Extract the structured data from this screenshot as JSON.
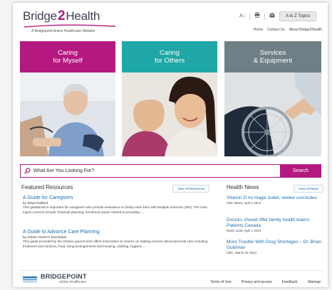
{
  "header": {
    "logo_left": "Bridge",
    "logo_number": "2",
    "logo_right": "Health",
    "tagline": "A Bridgepoint Active Healthcare Website",
    "text_size_label": "A↕",
    "atoz_label": "A to Z Topics",
    "top_links": [
      "Home",
      "Contact Us",
      "About Bridge2Health"
    ]
  },
  "tiles": [
    {
      "line1": "Caring",
      "line2": "for Myself",
      "color": "#b3197f"
    },
    {
      "line1": "Caring",
      "line2": "for Others",
      "color": "#1fa7a7"
    },
    {
      "line1": "Services",
      "line2": "& Equipment",
      "color": "#6f7f86"
    }
  ],
  "search": {
    "placeholder": "What Are You Looking For?",
    "button_label": "Search"
  },
  "featured": {
    "title": "Featured Resources",
    "view_all": "View All Resources",
    "items": [
      {
        "title": "A Guide for Caregivers",
        "by": "by Tanya Radford",
        "desc": "This guidebook is important for caregivers who provide assistance to family mem-bers with Multiple Sclerosis (MS). The main topics covered include: financial planning; emotional issues related to providing ..."
      },
      {
        "title": "A Guide to Advance Care Planning",
        "by": "by Ontario Senior's Secretariat",
        "desc": "This guide provided by the Ontario government offers information to seniors on making choices about personal care including treatment and services, food, living arrangements and housing, clothing, hygiene ..."
      }
    ]
  },
  "news": {
    "title": "Health News",
    "view_all": "View All News",
    "items": [
      {
        "title": "Vitamin D no magic bullet, review concludes",
        "source": "CBC News, April 1 2014"
      },
      {
        "title": "Doctors should offer family health teams: Patients Canada",
        "source": "News 1130, April 1 2014"
      },
      {
        "title": "More Trouble With Drug Shortages – Dr. Brian Goldman",
        "source": "CBC, March 31 2014"
      }
    ]
  },
  "footer": {
    "brand": "BRIDGEPOINT",
    "brand_sub": "active healthcare",
    "links": [
      "Terms of Use",
      "Privacy and access",
      "Feedback",
      "Sitemap"
    ]
  },
  "colors": {
    "brand_magenta": "#b3197f",
    "teal": "#1fa7a7",
    "slate": "#6f7f86",
    "link_blue": "#1a6fb3"
  }
}
